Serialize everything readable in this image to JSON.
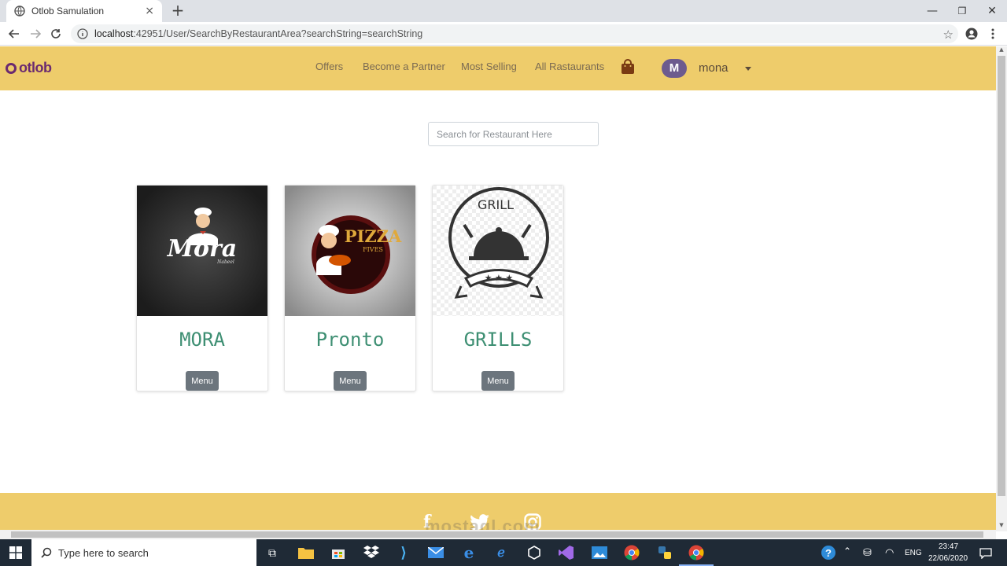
{
  "browser": {
    "tab_title": "Otlob Samulation",
    "tab_close": "×",
    "new_tab": "+",
    "window_controls": [
      "—",
      "❐",
      "✕"
    ],
    "url_host": "localhost",
    "url_path": ":42951/User/SearchByRestaurantArea?searchString=searchString"
  },
  "site": {
    "logo": "otlob",
    "nav": [
      "Offers",
      "Become a Partner",
      "Most Selling",
      "All Rastaurants"
    ],
    "user": {
      "initial": "M",
      "name": "mona"
    },
    "search_placeholder": "Search for Restaurant Here",
    "restaurants": [
      {
        "name": "MORA",
        "logo_text": "Mora",
        "logo_sub": "Nabeel",
        "button": "Menu"
      },
      {
        "name": "Pronto",
        "logo_text": "PIZZA",
        "logo_sub": "FIVES",
        "button": "Menu"
      },
      {
        "name": "GRILLS",
        "logo_text": "GRILL",
        "button": "Menu"
      }
    ],
    "footer_watermark": "mostaql.com",
    "colors": {
      "nav_bg": "#eecc6b",
      "brand": "#6b2a70",
      "title_green": "#3e8f73",
      "button": "#6c757d"
    }
  },
  "taskbar": {
    "search_placeholder": "Type here to search",
    "tray": {
      "lang": "ENG",
      "time": "23:47",
      "date": "22/06/2020"
    }
  }
}
